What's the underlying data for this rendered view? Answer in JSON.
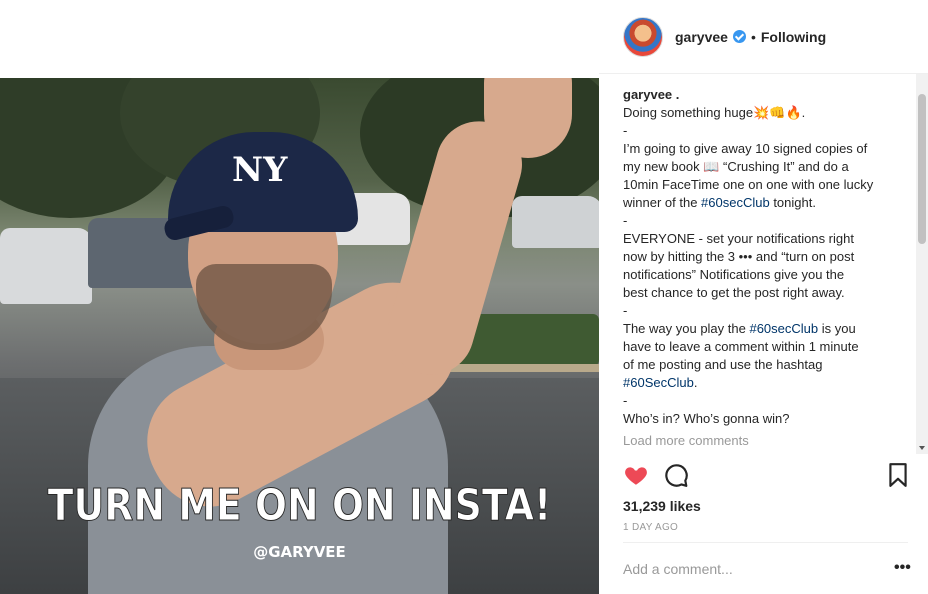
{
  "post": {
    "image": {
      "caption_text": "TURN ME ON ON INSTA!",
      "handle_text": "@GARYVEE",
      "cap_logo": "NY"
    }
  },
  "header": {
    "username": "garyvee",
    "separator": "•",
    "follow_status": "Following",
    "verified_icon": "verified-badge-icon",
    "colors": {
      "verified": "#3897f0"
    }
  },
  "caption": {
    "username": "garyvee .",
    "lines": [
      "Doing something huge💥👊🔥.",
      "-",
      "I’m going to give away 10 signed copies of",
      "my new book 📖 “Crushing It” and do a",
      "10min FaceTime one on one with one lucky",
      "winner of the #60secClub tonight.",
      "-",
      "EVERYONE - set your notifications right",
      "now by hitting the 3 ••• and “turn on post",
      "notifications” Notifications give you the",
      "best chance to get the post right away.",
      "-",
      "The way you play the #60secClub is you",
      "have to leave a comment within 1 minute",
      "of me posting and use the hashtag",
      "#60SecClub.",
      "-",
      "Who’s in? Who’s gonna win?"
    ],
    "load_more": "Load more comments"
  },
  "actions": {
    "like_icon": "heart-icon",
    "comment_icon": "comment-icon",
    "save_icon": "bookmark-icon",
    "colors": {
      "liked": "#ed4956"
    }
  },
  "likes": {
    "text": "31,239 likes"
  },
  "timestamp": {
    "text": "1 DAY AGO"
  },
  "comment": {
    "placeholder": "Add a comment...",
    "more_label": "•••"
  }
}
